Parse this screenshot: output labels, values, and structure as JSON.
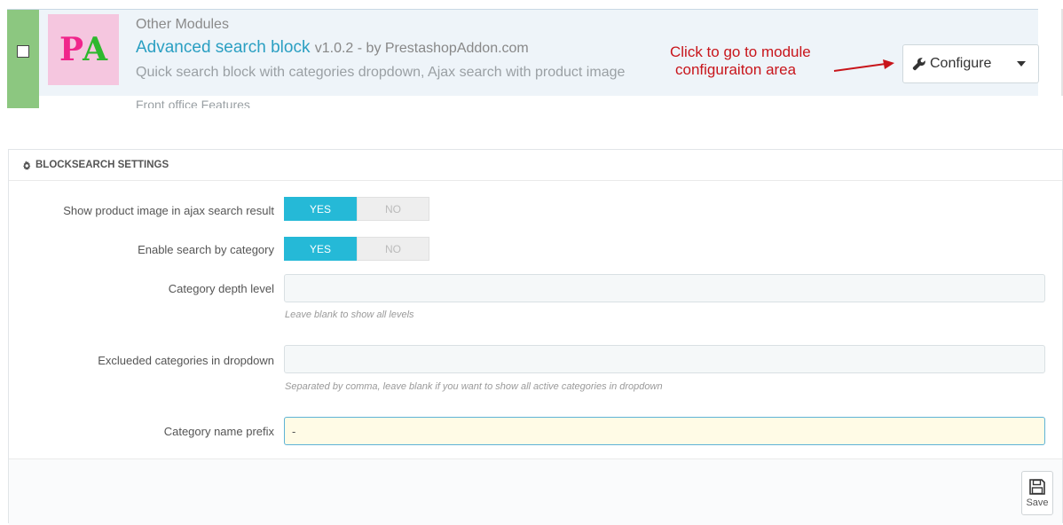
{
  "module": {
    "category": "Other Modules",
    "title": "Advanced search block",
    "version_author": "v1.0.2 - by PrestashopAddon.com",
    "description": "Quick search block with categories dropdown, Ajax search with product image",
    "logo_letters": [
      "P",
      "A"
    ],
    "next_module_text": "Front office Features",
    "configure_label": "Configure"
  },
  "annotation": {
    "line1": "Click to go to module",
    "line2": "configuraiton area",
    "color": "#c8151b"
  },
  "panel": {
    "heading": "BLOCKSEARCH SETTINGS",
    "fields": {
      "show_image": {
        "label": "Show product image in ajax search result",
        "yes": "YES",
        "no": "NO",
        "value": "YES"
      },
      "search_by_category": {
        "label": "Enable search by category",
        "yes": "YES",
        "no": "NO",
        "value": "YES"
      },
      "depth": {
        "label": "Category depth level",
        "value": "",
        "help": "Leave blank to show all levels"
      },
      "excluded": {
        "label": "Exclueded categories in dropdown",
        "value": "",
        "help": "Separated by comma, leave blank if you want to show all active categories in dropdown"
      },
      "prefix": {
        "label": "Category name prefix",
        "value": "-"
      }
    },
    "save_label": "Save"
  },
  "colors": {
    "accent": "#25b9d7",
    "module_link": "#2a9fc2",
    "status_strip": "#8cc780",
    "focus_bg": "#fffbe6"
  },
  "icons": [
    "wrench-icon",
    "caret-down-icon",
    "cog-icon",
    "save-icon",
    "arrow-icon"
  ]
}
